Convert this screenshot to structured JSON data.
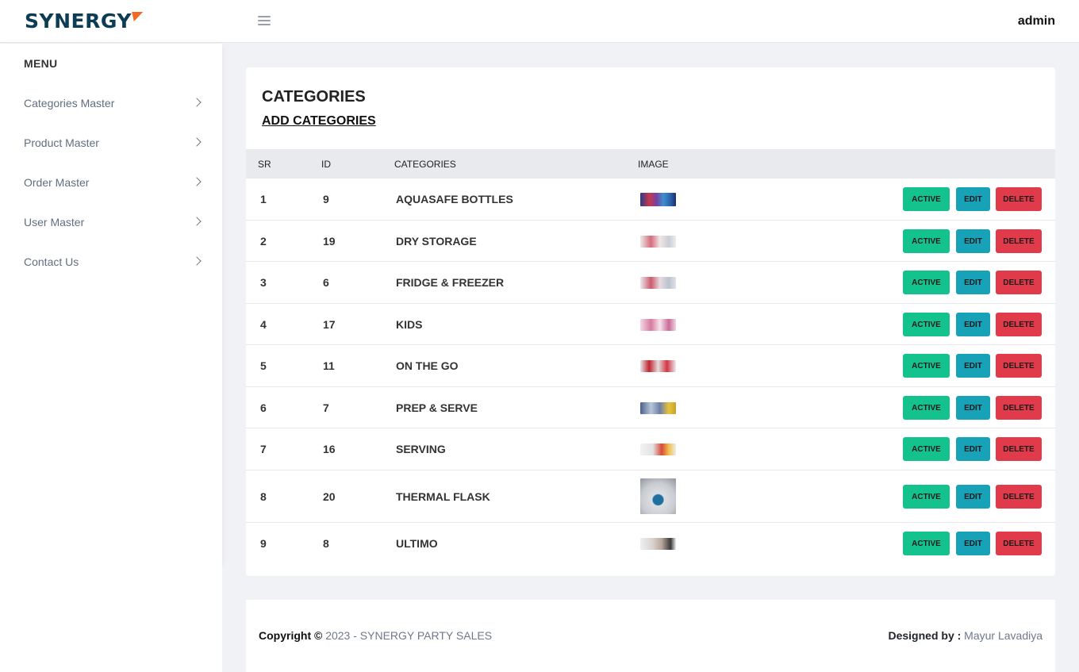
{
  "brand": {
    "name": "SYNERGY"
  },
  "header": {
    "menu_icon": "hamburger-icon",
    "user": "admin"
  },
  "sidebar": {
    "title": "MENU",
    "items": [
      {
        "label": "Categories Master"
      },
      {
        "label": "Product Master"
      },
      {
        "label": "Order Master"
      },
      {
        "label": "User Master"
      },
      {
        "label": "Contact Us"
      }
    ]
  },
  "page": {
    "title": "CATEGORIES",
    "add_link": "ADD CATEGORIES"
  },
  "table": {
    "headers": {
      "sr": "SR",
      "id": "ID",
      "categories": "CATEGORIES",
      "image": "IMAGE"
    },
    "rows": [
      {
        "sr": "1",
        "id": "9",
        "name": "AQUASAFE BOTTLES"
      },
      {
        "sr": "2",
        "id": "19",
        "name": "DRY STORAGE"
      },
      {
        "sr": "3",
        "id": "6",
        "name": "FRIDGE & FREEZER"
      },
      {
        "sr": "4",
        "id": "17",
        "name": "KIDS"
      },
      {
        "sr": "5",
        "id": "11",
        "name": "ON THE GO"
      },
      {
        "sr": "6",
        "id": "7",
        "name": "PREP & SERVE"
      },
      {
        "sr": "7",
        "id": "16",
        "name": "SERVING"
      },
      {
        "sr": "8",
        "id": "20",
        "name": "THERMAL FLASK"
      },
      {
        "sr": "9",
        "id": "8",
        "name": "ULTIMO"
      }
    ],
    "actions": {
      "active": "ACTIVE",
      "edit": "EDIT",
      "delete": "DELETE"
    }
  },
  "footer": {
    "copyright_label": "Copyright ©",
    "copyright_text": "2023 - SYNERGY PARTY SALES",
    "designed_label": "Designed by :",
    "designer": "Mayur Lavadiya"
  },
  "colors": {
    "brand": "#0d3c55",
    "brand_accent": "#f26a21",
    "active": "#14c28e",
    "edit": "#17a2b8",
    "delete": "#e13a4b"
  }
}
